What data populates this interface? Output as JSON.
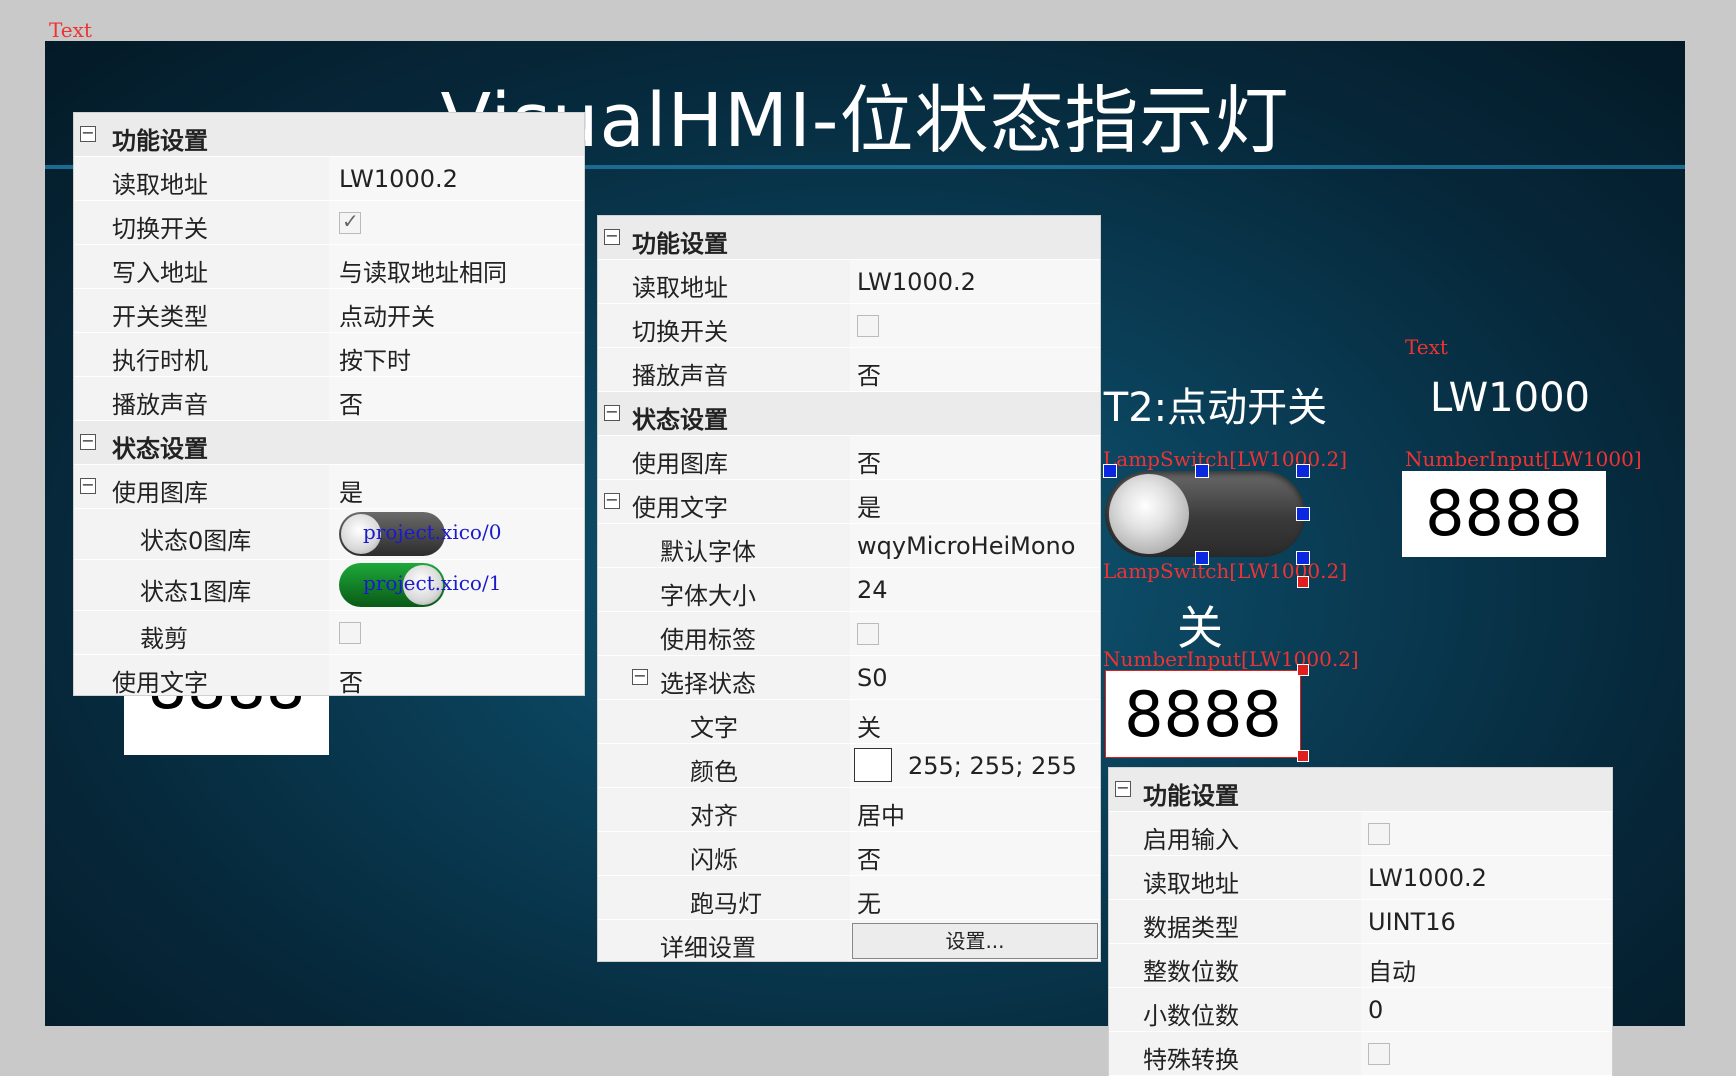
{
  "top_text_label": "Text",
  "title": "VisualHMI-位状态指示灯",
  "canvas": {
    "section2_title": "IT2:点动开关",
    "lw_label_title": "Text",
    "lw_label": "LW1000",
    "numinput_top_label": "NumberInput[LW1000]",
    "numinput_top_value": "8888",
    "lamp_switch_label_top": "LampSwitch[LW1000.2]",
    "lamp_switch_label_bottom": "LampSwitch[LW1000.2]",
    "off_text": "关",
    "numinput_mid_label": "NumberInput[LW1000.2]",
    "numinput_mid_value": "8888",
    "numinput_left_value": "8888"
  },
  "panel1": {
    "sections": [
      {
        "label": "功能设置"
      },
      {
        "label": "状态设置"
      }
    ],
    "rows": {
      "read_addr": {
        "label": "读取地址",
        "value": "LW1000.2"
      },
      "toggle_switch": {
        "label": "切换开关",
        "checked": true
      },
      "write_addr": {
        "label": "写入地址",
        "value": "与读取地址相同"
      },
      "switch_type": {
        "label": "开关类型",
        "value": "点动开关"
      },
      "exec_timing": {
        "label": "执行时机",
        "value": "按下时"
      },
      "play_sound": {
        "label": "播放声音",
        "value": "否"
      },
      "use_gallery": {
        "label": "使用图库",
        "value": "是"
      },
      "state0": {
        "label": "状态0图库",
        "value": "project.xico/0"
      },
      "state1": {
        "label": "状态1图库",
        "value": "project.xico/1"
      },
      "crop": {
        "label": "裁剪",
        "checked": false
      },
      "use_text": {
        "label": "使用文字",
        "value": "否"
      }
    }
  },
  "panel2": {
    "sections": [
      {
        "label": "功能设置"
      },
      {
        "label": "状态设置"
      }
    ],
    "rows": {
      "read_addr": {
        "label": "读取地址",
        "value": "LW1000.2"
      },
      "toggle_switch": {
        "label": "切换开关",
        "checked": false
      },
      "play_sound": {
        "label": "播放声音",
        "value": "否"
      },
      "use_gallery": {
        "label": "使用图库",
        "value": "否"
      },
      "use_text": {
        "label": "使用文字",
        "value": "是"
      },
      "default_font": {
        "label": "默认字体",
        "value": "wqyMicroHeiMono"
      },
      "font_size": {
        "label": "字体大小",
        "value": "24"
      },
      "use_tag": {
        "label": "使用标签",
        "checked": false
      },
      "select_state": {
        "label": "选择状态",
        "value": "S0"
      },
      "text": {
        "label": "文字",
        "value": "关"
      },
      "color": {
        "label": "颜色",
        "value": "255; 255; 255",
        "swatch": "#ffffff"
      },
      "align": {
        "label": "对齐",
        "value": "居中"
      },
      "blink": {
        "label": "闪烁",
        "value": "否"
      },
      "marquee": {
        "label": "跑马灯",
        "value": "无"
      },
      "details": {
        "label": "详细设置",
        "button": "设置..."
      }
    }
  },
  "panel3": {
    "section": "功能设置",
    "rows": {
      "enable_input": {
        "label": "启用输入",
        "checked": false
      },
      "read_addr": {
        "label": "读取地址",
        "value": "LW1000.2"
      },
      "data_type": {
        "label": "数据类型",
        "value": "UINT16"
      },
      "int_digits": {
        "label": "整数位数",
        "value": "自动"
      },
      "dec_digits": {
        "label": "小数位数",
        "value": "0"
      },
      "special_conv": {
        "label": "特殊转换",
        "checked": false
      }
    }
  },
  "colors": {
    "accent_blue": "#0a28e0",
    "marker_red": "#e33333",
    "toggle_on_green": "#0f7a1e"
  }
}
